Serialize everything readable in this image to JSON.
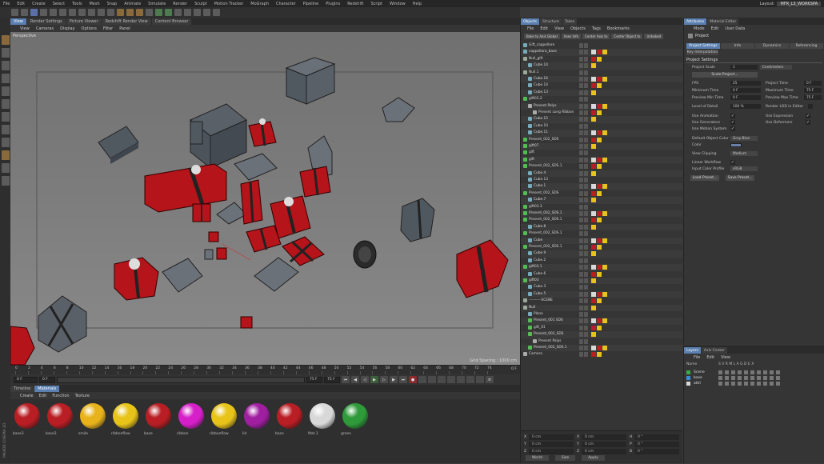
{
  "menu": [
    "File",
    "Edit",
    "Create",
    "Select",
    "Tools",
    "Mesh",
    "Snap",
    "Animate",
    "Simulate",
    "Render",
    "Sculpt",
    "Motion Tracker",
    "MoGraph",
    "Character",
    "Pipeline",
    "Plugins",
    "Redshift",
    "Script",
    "Window",
    "Help"
  ],
  "layout": {
    "label": "Layout:",
    "value": "MFR_L3_WORKSPA"
  },
  "viewport": {
    "tabs": [
      "View",
      "Render Settings",
      "Picture Viewer",
      "Redshift Render View",
      "Content Browser"
    ],
    "menu": [
      "View",
      "Cameras",
      "Display",
      "Options",
      "Filter",
      "Panel"
    ],
    "label": "Perspective",
    "grid_spacing": "Grid Spacing : 1000 cm"
  },
  "timeline": {
    "ticks": [
      "0",
      "2",
      "4",
      "6",
      "8",
      "10",
      "12",
      "14",
      "16",
      "18",
      "20",
      "22",
      "24",
      "26",
      "28",
      "30",
      "32",
      "34",
      "36",
      "38",
      "40",
      "42",
      "44",
      "46",
      "48",
      "50",
      "52",
      "54",
      "56",
      "58",
      "60",
      "62",
      "64",
      "66",
      "68",
      "70",
      "72",
      "74"
    ],
    "end_label": "0 F",
    "current_frame": "0 F",
    "start_frame": "0 F",
    "end_frame": "75 F",
    "end_frame2": "75 F"
  },
  "materials": {
    "tabs": [
      "Timeline",
      "Materials"
    ],
    "menu": [
      "Create",
      "Edit",
      "Function",
      "Texture"
    ],
    "items": [
      {
        "name": "base3",
        "color": "#b81e24"
      },
      {
        "name": "base2",
        "color": "#b81e24"
      },
      {
        "name": "smile",
        "color": "#e8b21a"
      },
      {
        "name": "ribbonflow",
        "color": "#e8c41a"
      },
      {
        "name": "base",
        "color": "#b81e24"
      },
      {
        "name": "ribbon",
        "color": "#d61fc8"
      },
      {
        "name": "ribbonflow",
        "color": "#e8c41a"
      },
      {
        "name": "lid",
        "color": "#a01ea0"
      },
      {
        "name": "base",
        "color": "#b81e24"
      },
      {
        "name": "Mat.1",
        "color": "#d8d8d8"
      },
      {
        "name": "green",
        "color": "#2e9a3a"
      }
    ],
    "side_label": "MAXON CINEMA 4D"
  },
  "objects": {
    "tabs": [
      "Objects",
      "Structure",
      "Takes"
    ],
    "menu": [
      "File",
      "Edit",
      "View",
      "Objects",
      "Tags",
      "Bookmarks"
    ],
    "buttons": [
      "Bake to Axis Global",
      "Axes Info",
      "Center Axis to",
      "Center Object to",
      "Unbaked"
    ],
    "rows": [
      {
        "name": "Gift_cappellare",
        "indent": 0,
        "icon": "#7ab"
      },
      {
        "name": "cappellara_base",
        "indent": 0,
        "icon": "#7ab"
      },
      {
        "name": "Null_gift",
        "indent": 0,
        "icon": "#9a9"
      },
      {
        "name": "Cube.14",
        "indent": 1,
        "icon": "#7ab"
      },
      {
        "name": "Null.1",
        "indent": 0,
        "icon": "#9a9"
      },
      {
        "name": "Cube.16",
        "indent": 1,
        "icon": "#7ab"
      },
      {
        "name": "Cube.14",
        "indent": 1,
        "icon": "#7ab"
      },
      {
        "name": "Cube.13",
        "indent": 1,
        "icon": "#7ab"
      },
      {
        "name": "gift03.2",
        "indent": 0,
        "icon": "#5b5"
      },
      {
        "name": "Present Polys",
        "indent": 1,
        "icon": "#aaa"
      },
      {
        "name": "Present Long Ribbon",
        "indent": 2,
        "icon": "#aaa"
      },
      {
        "name": "Cube.15",
        "indent": 1,
        "icon": "#7ab"
      },
      {
        "name": "Cube.10",
        "indent": 1,
        "icon": "#7ab"
      },
      {
        "name": "Cube.11",
        "indent": 1,
        "icon": "#7ab"
      },
      {
        "name": "Present_002_SDS",
        "indent": 0,
        "icon": "#5b5"
      },
      {
        "name": "gift07",
        "indent": 0,
        "icon": "#5b5"
      },
      {
        "name": "gift",
        "indent": 0,
        "icon": "#5b5"
      },
      {
        "name": "gift",
        "indent": 0,
        "icon": "#5b5"
      },
      {
        "name": "Present_002_SDS.1",
        "indent": 0,
        "icon": "#5b5"
      },
      {
        "name": "Cube.4",
        "indent": 1,
        "icon": "#7ab"
      },
      {
        "name": "Cube.13",
        "indent": 1,
        "icon": "#7ab"
      },
      {
        "name": "Cube.1",
        "indent": 1,
        "icon": "#7ab"
      },
      {
        "name": "Present_002_SDS",
        "indent": 0,
        "icon": "#5b5"
      },
      {
        "name": "Cube.7",
        "indent": 1,
        "icon": "#7ab"
      },
      {
        "name": "gift03.3",
        "indent": 0,
        "icon": "#5b5"
      },
      {
        "name": "Present_002_SDS.1",
        "indent": 0,
        "icon": "#5b5"
      },
      {
        "name": "Present_002_SDS.1",
        "indent": 0,
        "icon": "#5b5"
      },
      {
        "name": "Cube.8",
        "indent": 1,
        "icon": "#7ab"
      },
      {
        "name": "Present_002_SDS.1",
        "indent": 0,
        "icon": "#5b5"
      },
      {
        "name": "Cube",
        "indent": 1,
        "icon": "#7ab"
      },
      {
        "name": "Present_002_SDS.1",
        "indent": 0,
        "icon": "#5b5"
      },
      {
        "name": "Cube.9",
        "indent": 1,
        "icon": "#7ab"
      },
      {
        "name": "Cube.2",
        "indent": 1,
        "icon": "#7ab"
      },
      {
        "name": "gift03.1",
        "indent": 0,
        "icon": "#5b5"
      },
      {
        "name": "Cube.6",
        "indent": 1,
        "icon": "#7ab"
      },
      {
        "name": "gift03",
        "indent": 0,
        "icon": "#5b5"
      },
      {
        "name": "Cube.3",
        "indent": 1,
        "icon": "#7ab"
      },
      {
        "name": "Cube.5",
        "indent": 1,
        "icon": "#7ab"
      },
      {
        "name": "----------SCENE",
        "indent": 0,
        "icon": "#9a9"
      },
      {
        "name": "Null",
        "indent": 0,
        "icon": "#9a9"
      },
      {
        "name": "Plane",
        "indent": 1,
        "icon": "#7ab"
      },
      {
        "name": "Present_001 SDS",
        "indent": 1,
        "icon": "#5b5"
      },
      {
        "name": "gift_01",
        "indent": 1,
        "icon": "#5b5"
      },
      {
        "name": "Present_002_SDS",
        "indent": 1,
        "icon": "#5b5"
      },
      {
        "name": "Present Polys",
        "indent": 2,
        "icon": "#aaa"
      },
      {
        "name": "Present_002_SDS.1",
        "indent": 1,
        "icon": "#5b5"
      },
      {
        "name": "Camera",
        "indent": 0,
        "icon": "#aaa"
      }
    ],
    "coords": {
      "rows": [
        {
          "a": "X",
          "av": "0 cm",
          "b": "X",
          "bv": "0 cm",
          "c": "H",
          "cv": "0 °"
        },
        {
          "a": "Y",
          "av": "0 cm",
          "b": "Y",
          "bv": "0 cm",
          "c": "P",
          "cv": "0 °"
        },
        {
          "a": "Z",
          "av": "0 cm",
          "b": "Z",
          "bv": "0 cm",
          "c": "B",
          "cv": "0 °"
        }
      ],
      "buttons": [
        "World",
        "Size",
        "Apply"
      ]
    }
  },
  "attributes": {
    "tabs": [
      "Attributes",
      "Material Editor"
    ],
    "menu": [
      "Mode",
      "Edit",
      "User Data"
    ],
    "object": "Project",
    "subtabs": [
      "Project Settings",
      "Info",
      "Dynamics",
      "Referencing"
    ],
    "subtab2": "Key Interpolation",
    "section": "Project Settings",
    "project_scale_label": "Project Scale",
    "project_scale_value": "1",
    "project_scale_unit": "Centimeters",
    "scale_project_btn": "Scale Project...",
    "fps_label": "FPS",
    "fps_value": "25",
    "project_time_label": "Project Time",
    "project_time_value": "0 F",
    "min_time_label": "Minimum Time",
    "min_time_value": "0 F",
    "max_time_label": "Maximum Time",
    "max_time_value": "75 F",
    "prev_min_label": "Preview Min Time",
    "prev_min_value": "0 F",
    "prev_max_label": "Preview Max Time",
    "prev_max_value": "75 F",
    "lod_label": "Level of Detail",
    "lod_value": "100 %",
    "render_lod_label": "Render LOD in Editor",
    "use_anim": "Use Animation",
    "use_expr": "Use Expression",
    "use_gen": "Use Generators",
    "use_def": "Use Deformers",
    "use_motion": "Use Motion System",
    "default_color_label": "Default Object Color",
    "default_color_value": "Gray-Blue",
    "color_label": "Color",
    "view_clip_label": "View Clipping",
    "view_clip_value": "Medium",
    "linear_label": "Linear Workflow",
    "input_profile_label": "Input Color Profile",
    "input_profile_value": "sRGB",
    "load_preset": "Load Preset...",
    "save_preset": "Save Preset..."
  },
  "layers": {
    "tabs": [
      "Layers",
      "Axis Center"
    ],
    "menu": [
      "File",
      "Edit",
      "View"
    ],
    "header": "Name",
    "header_cols": "S V R M L A G D E X",
    "rows": [
      {
        "name": "Scene",
        "color": "#3aa84a"
      },
      {
        "name": "base",
        "color": "#3a8ad8"
      },
      {
        "name": "attri",
        "color": "#d8d8d8"
      }
    ]
  }
}
